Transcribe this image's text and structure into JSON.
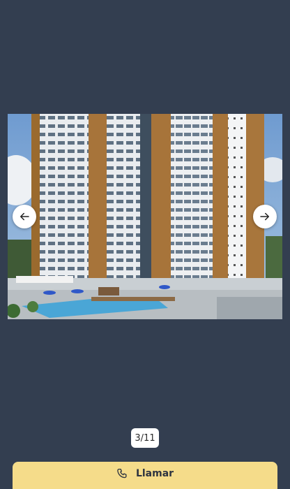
{
  "gallery": {
    "image_icon": "building-photo",
    "counter": "3/11",
    "prev_icon": "arrow-left-icon",
    "next_icon": "arrow-right-icon"
  },
  "actions": {
    "call_label": "Llamar",
    "call_icon": "phone-icon"
  },
  "colors": {
    "background": "#333e50",
    "call_button": "#f5dc8a"
  }
}
